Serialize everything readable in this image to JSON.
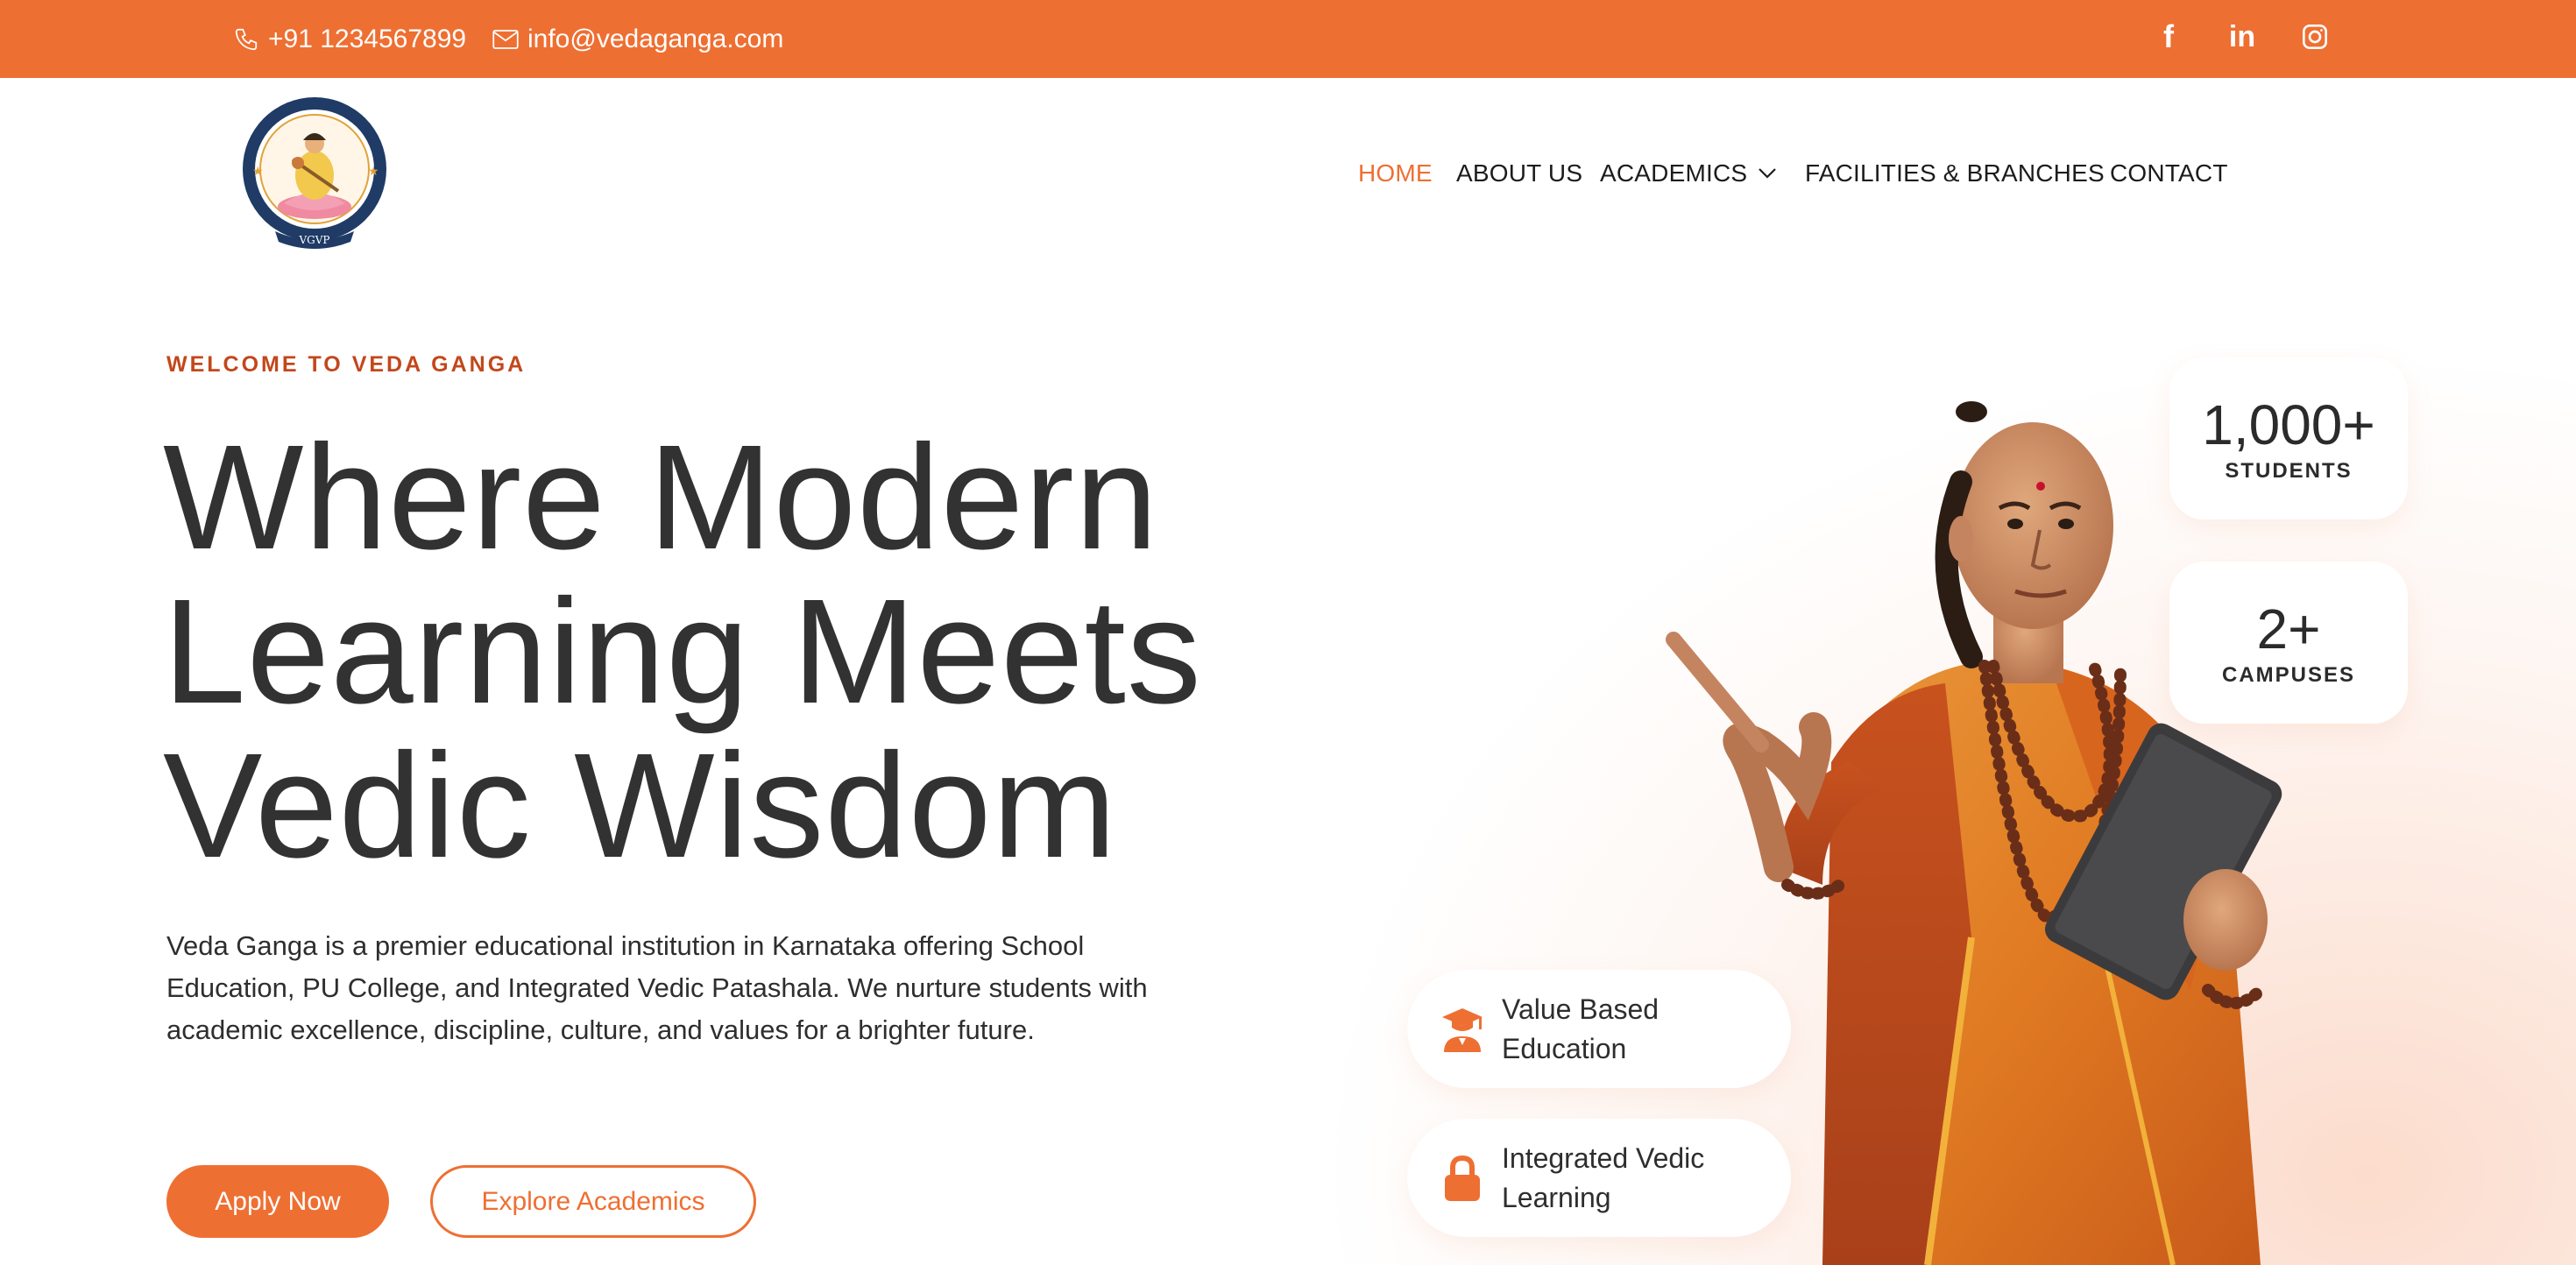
{
  "topbar": {
    "phone": "+91 1234567899",
    "email": "info@vedaganga.com",
    "social": [
      {
        "icon": "facebook-icon",
        "glyph": "f"
      },
      {
        "icon": "linkedin-icon",
        "glyph": "in"
      },
      {
        "icon": "instagram-icon"
      }
    ],
    "color": "#ee6f32"
  },
  "header": {
    "logo": {
      "inscription": "VGVP"
    },
    "nav": [
      {
        "label": "HOME",
        "active": true
      },
      {
        "label": "ABOUT US",
        "active": false
      },
      {
        "label": "ACADEMICS",
        "active": false,
        "dropdown": true
      },
      {
        "label": "FACILITIES & BRANCHES",
        "active": false
      },
      {
        "label": "CONTACT",
        "active": false
      }
    ]
  },
  "hero": {
    "eyebrow": "WELCOME TO VEDA GANGA",
    "headline": [
      "Where Modern",
      "Learning Meets",
      "Vedic Wisdom"
    ],
    "intro": "Veda Ganga is a premier educational institution in Karnataka offering School Education, PU College, and Integrated Vedic Patashala. We nurture students with academic excellence, discipline, culture, and values for a brighter future.",
    "primary_button": "Apply Now",
    "secondary_button": "Explore Academics"
  },
  "stats": [
    {
      "value": "1,000+",
      "label": "STUDENTS"
    },
    {
      "value": "2+",
      "label": "CAMPUSES"
    }
  ],
  "features": [
    {
      "icon": "graduate-icon",
      "label": "Value Based Education"
    },
    {
      "icon": "lock-icon",
      "label": "Integrated Vedic Learning"
    }
  ],
  "colors": {
    "accent": "#ee6f32",
    "eyebrow": "#c3471b",
    "text": "#323232"
  }
}
